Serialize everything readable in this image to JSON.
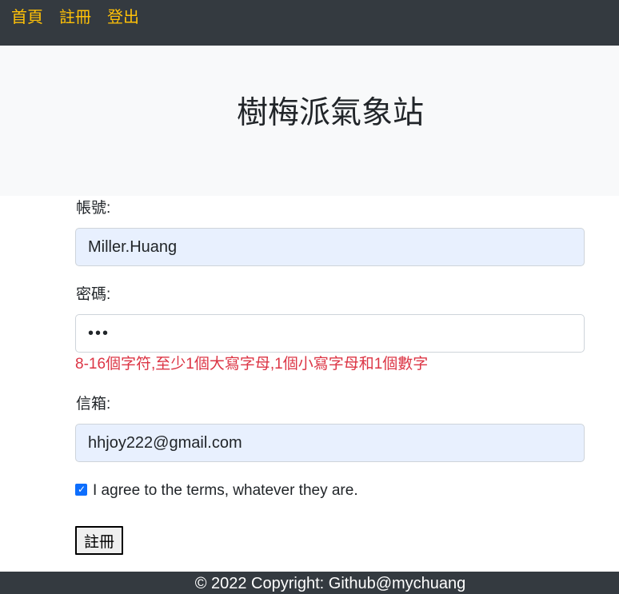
{
  "nav": {
    "items": [
      {
        "label": "首頁"
      },
      {
        "label": "註冊"
      },
      {
        "label": "登出"
      }
    ]
  },
  "hero": {
    "title": "樹梅派氣象站"
  },
  "form": {
    "username": {
      "label": "帳號:",
      "value": "Miller.Huang"
    },
    "password": {
      "label": "密碼:",
      "value": "•••",
      "hint": "8-16個字符,至少1個大寫字母,1個小寫字母和1個數字"
    },
    "email": {
      "label": "信箱:",
      "value": "hhjoy222@gmail.com"
    },
    "agree": {
      "label": "I agree to the terms, whatever they are.",
      "checked": true
    },
    "submit_label": "註冊"
  },
  "footer": {
    "text": "© 2022 Copyright: Github@mychuang"
  },
  "colors": {
    "navbar_bg": "#343a40",
    "nav_link": "#ffc107",
    "hero_bg": "#f8f9fa",
    "hint": "#dc3545",
    "autofill_bg": "#e8f0fe",
    "checkbox": "#0d6efd"
  }
}
